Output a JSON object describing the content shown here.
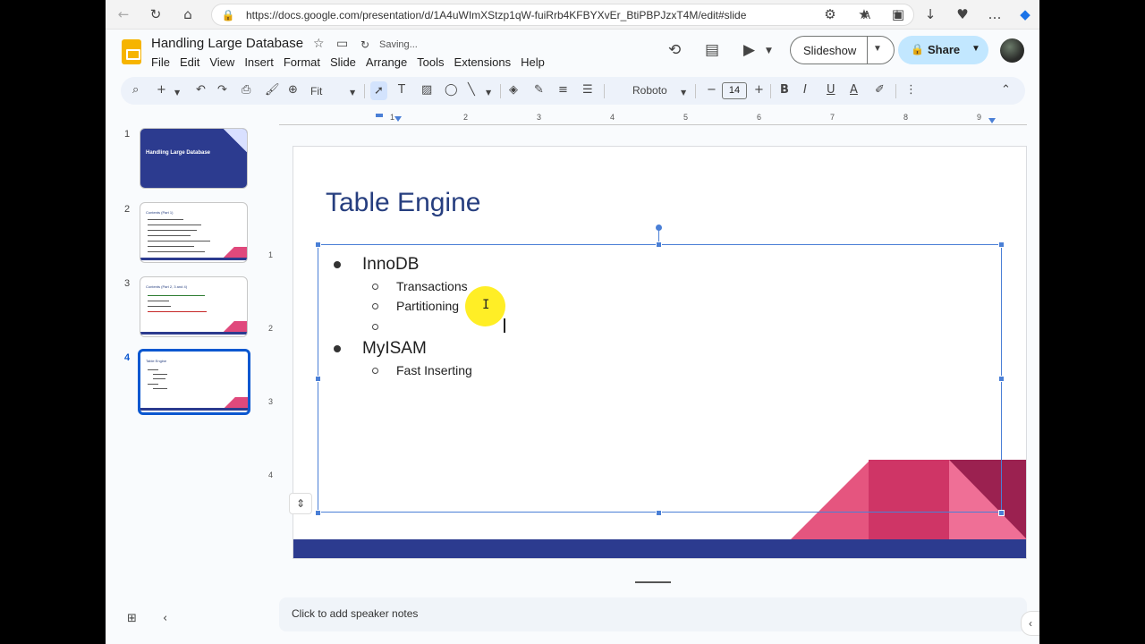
{
  "browser": {
    "url": "https://docs.google.com/presentation/d/1A4uWImXStzp1qW-fuiRrb4KFBYXvEr_BtiPBPJzxT4M/edit#slide=id...."
  },
  "header": {
    "title": "Handling Large Database",
    "status": "Saving...",
    "menu": [
      "File",
      "Edit",
      "View",
      "Insert",
      "Format",
      "Slide",
      "Arrange",
      "Tools",
      "Extensions",
      "Help"
    ],
    "slideshow_label": "Slideshow",
    "share_label": "Share"
  },
  "toolbar": {
    "zoom": "Fit",
    "font": "Roboto",
    "font_size": "14"
  },
  "ruler": {
    "h_numbers": [
      "1",
      "2",
      "3",
      "4",
      "5",
      "6",
      "7",
      "8",
      "9"
    ],
    "v_numbers": [
      "1",
      "2",
      "3",
      "4"
    ]
  },
  "filmstrip": {
    "slides": [
      {
        "num": "1",
        "title": "Handling Large Database"
      },
      {
        "num": "2",
        "title": "Contents (Part 1)"
      },
      {
        "num": "3",
        "title": "Contents (Part 2, 3 and 4)"
      },
      {
        "num": "4",
        "title": "Table Engine"
      }
    ]
  },
  "slide": {
    "title": "Table Engine",
    "items": [
      {
        "text": "InnoDB",
        "level": 1
      },
      {
        "text": "Transactions",
        "level": 2
      },
      {
        "text": "Partitioning",
        "level": 2
      },
      {
        "text": "",
        "level": 2
      },
      {
        "text": "MyISAM",
        "level": 1
      },
      {
        "text": "Fast Inserting",
        "level": 2
      }
    ]
  },
  "notes": {
    "placeholder": "Click to add speaker notes"
  },
  "colors": {
    "title_blue": "#263e7f",
    "footer_navy": "#2c3b8f",
    "accent_pink": "#cf3566",
    "selection_blue": "#4a7fd6",
    "share_bg": "#c2e7ff"
  }
}
